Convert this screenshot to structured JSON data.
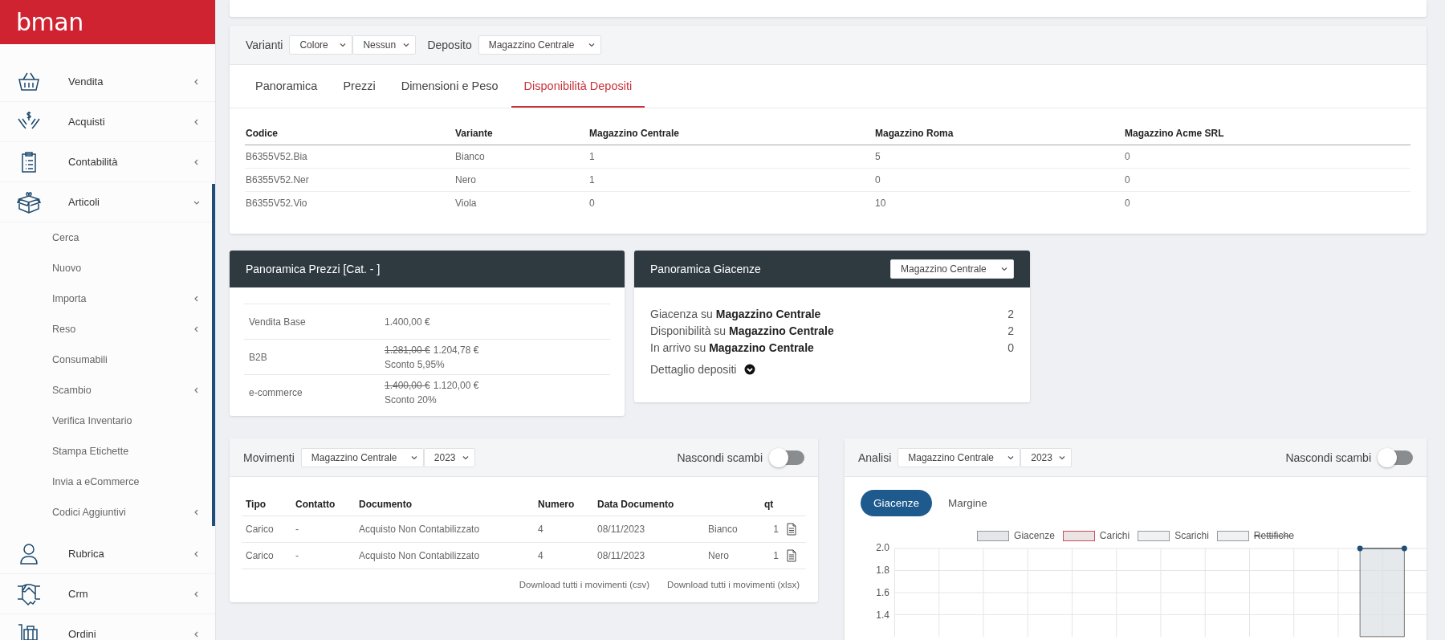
{
  "brand": {
    "logo": "bman"
  },
  "sidebar": {
    "items": [
      {
        "label": "Vendita",
        "expanded": false
      },
      {
        "label": "Acquisti",
        "expanded": false
      },
      {
        "label": "Contabilità",
        "expanded": false
      },
      {
        "label": "Articoli",
        "expanded": true,
        "children": [
          {
            "label": "Cerca",
            "expandable": false
          },
          {
            "label": "Nuovo",
            "expandable": false
          },
          {
            "label": "Importa",
            "expandable": true
          },
          {
            "label": "Reso",
            "expandable": true
          },
          {
            "label": "Consumabili",
            "expandable": false
          },
          {
            "label": "Scambio",
            "expandable": true
          },
          {
            "label": "Verifica Inventario",
            "expandable": false
          },
          {
            "label": "Stampa Etichette",
            "expandable": false
          },
          {
            "label": "Invia a eCommerce",
            "expandable": false
          },
          {
            "label": "Codici Aggiuntivi",
            "expandable": true
          }
        ]
      },
      {
        "label": "Rubrica",
        "expanded": false
      },
      {
        "label": "Crm",
        "expanded": false
      },
      {
        "label": "Ordini",
        "expanded": false
      }
    ]
  },
  "variants_bar": {
    "label": "Varianti",
    "selects": [
      "Colore",
      "Nessun"
    ],
    "deposit_label": "Deposito",
    "deposit_select": "Magazzino Centrale"
  },
  "tabs": [
    {
      "label": "Panoramica",
      "selected": false
    },
    {
      "label": "Prezzi",
      "selected": false
    },
    {
      "label": "Dimensioni e Peso",
      "selected": false
    },
    {
      "label": "Disponibilità Depositi",
      "selected": true
    }
  ],
  "stock_table": {
    "columns": [
      "Codice",
      "Variante",
      "Magazzino Centrale",
      "Magazzino Roma",
      "Magazzino Acme SRL"
    ],
    "rows": [
      [
        "B6355V52.Bia",
        "Bianco",
        "1",
        "5",
        "0"
      ],
      [
        "B6355V52.Ner",
        "Nero",
        "1",
        "0",
        "0"
      ],
      [
        "B6355V52.Vio",
        "Viola",
        "0",
        "10",
        "0"
      ]
    ]
  },
  "prices_card": {
    "title": "Panoramica Prezzi [Cat. - ]",
    "rows": [
      {
        "label": "Vendita Base",
        "price": "1.400,00 €"
      },
      {
        "label": "B2B",
        "old_price": "1.281,00 €",
        "price": "1.204,78 €",
        "discount": "Sconto 5,95%"
      },
      {
        "label": "e-commerce",
        "old_price": "1.400,00 €",
        "price": "1.120,00 €",
        "discount": "Sconto 20%"
      }
    ]
  },
  "stock_card": {
    "title": "Panoramica Giacenze",
    "select": "Magazzino Centrale",
    "lines": [
      {
        "text": "Giacenza su **Magazzino Centrale**",
        "value": "2"
      },
      {
        "text": "Disponibilità su **Magazzino Centrale**",
        "value": "2"
      },
      {
        "text": "In arrivo su **Magazzino Centrale**",
        "value": "0"
      }
    ],
    "details_link": "Dettaglio depositi"
  },
  "movements": {
    "title": "Movimenti",
    "selects": [
      "Magazzino Centrale",
      "2023"
    ],
    "toggle": {
      "label": "Nascondi scambi",
      "on": false
    },
    "columns": [
      "Tipo",
      "Contatto",
      "Documento",
      "Numero",
      "Data Documento",
      "qt"
    ],
    "rows": [
      {
        "tipo": "Carico",
        "contatto": "-",
        "documento": "Acquisto Non Contabilizzato",
        "numero": "4",
        "data": "08/11/2023",
        "variante": "Bianco",
        "qt": "1"
      },
      {
        "tipo": "Carico",
        "contatto": "-",
        "documento": "Acquisto Non Contabilizzato",
        "numero": "4",
        "data": "08/11/2023",
        "variante": "Nero",
        "qt": "1"
      }
    ],
    "links": [
      "Download tutti i movimenti (csv)",
      "Download tutti i movimenti (xlsx)"
    ]
  },
  "analysis": {
    "title": "Analisi",
    "selects": [
      "Magazzino Centrale",
      "2023"
    ],
    "toggle": {
      "label": "Nascondi scambi",
      "on": false
    },
    "tabs": [
      {
        "label": "Giacenze",
        "selected": true
      },
      {
        "label": "Margine",
        "selected": false
      }
    ],
    "legend": [
      {
        "color": "#e4e6e9",
        "hidden": false
      },
      {
        "label": "Carichi",
        "color": "#ece3e5",
        "hidden": false
      },
      {
        "label": "Scarichi",
        "color": "#f0f1f3",
        "hidden": false
      },
      {
        "label": "Rettifiche",
        "color": "#eff1f3",
        "hidden": true
      }
    ],
    "chart_data": {
      "type": "area",
      "grid": true,
      "ylim": [
        1.2,
        2.0
      ],
      "yticks": [
        {
          "value": 1.4,
          "label": "1.4"
        },
        {
          "value": 1.6,
          "label": "1.6"
        },
        {
          "value": 1.8,
          "label": "1.8"
        },
        {
          "value": 2.0,
          "label": "2.0"
        }
      ],
      "series": [
        {
          "name": "Giacenze",
          "color": "#dcdfe3",
          "values": [
            null,
            null,
            null,
            null,
            null,
            null,
            null,
            null,
            null,
            null,
            2,
            2
          ]
        }
      ]
    }
  }
}
